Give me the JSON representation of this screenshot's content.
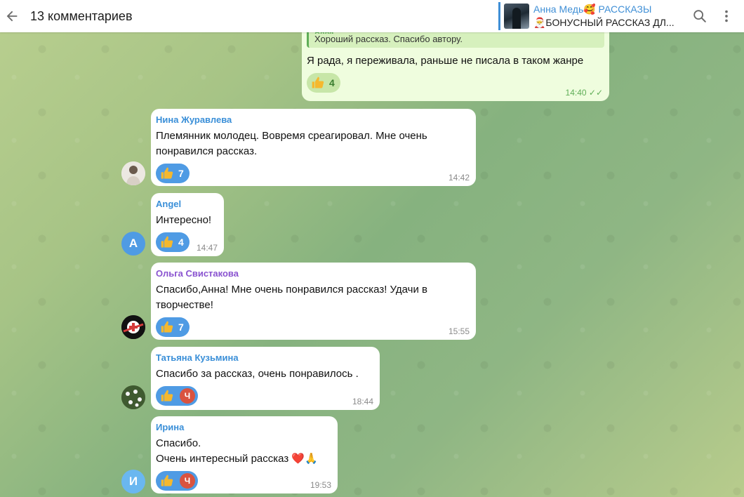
{
  "header": {
    "title": "13 комментариев",
    "pinned_name": "Анна Медь🥰 РАССКАЗЫ",
    "pinned_text": "🎅БОНУСНЫЙ РАССКАЗ ДЛ..."
  },
  "own_message": {
    "reply_name": "Анна",
    "reply_text": "Хороший рассказ. Спасибо автору.",
    "text": "Я рада, я переживала, раньше не писала в таком жанре",
    "reaction_count": "4",
    "time": "14:40"
  },
  "comments": [
    {
      "author": "Нина Журавлева",
      "author_color": "#3a8fd8",
      "text": "Племянник молодец. Вовремя среагировал.  Мне очень понравился рассказ.",
      "reaction_count": "7",
      "time": "14:42"
    },
    {
      "author": "Angel",
      "author_color": "#3a8fd8",
      "avatar_letter": "A",
      "avatar_color": "#4f9be4",
      "text": "Интересно!",
      "reaction_count": "4",
      "time": "14:47"
    },
    {
      "author": "Ольга Свистакова",
      "author_color": "#8a53d0",
      "text": "Спасибо,Анна! Мне очень понравился рассказ! Удачи в творчестве!",
      "reaction_count": "7",
      "time": "15:55"
    },
    {
      "author": "Татьяна Кузьмина",
      "author_color": "#3a8fd8",
      "text": "Спасибо за рассказ, очень понравилось .",
      "badge": "Ч",
      "time": "18:44"
    },
    {
      "author": "Ирина",
      "author_color": "#3a8fd8",
      "avatar_letter": "И",
      "avatar_color": "#6ab7f0",
      "text_line1": "Спасибо.",
      "text_line2": "Очень интересный рассказ ❤️🙏",
      "badge": "Ч",
      "time": "19:53"
    }
  ],
  "icons": {
    "back": "arrow-left-icon",
    "search": "search-icon",
    "menu": "more-vertical-icon",
    "reaction": "thumbs-up-icon"
  },
  "colors": {
    "accent": "#3f8fd6",
    "reaction_bg": "#4f9be4",
    "own_bubble": "#effdde"
  }
}
